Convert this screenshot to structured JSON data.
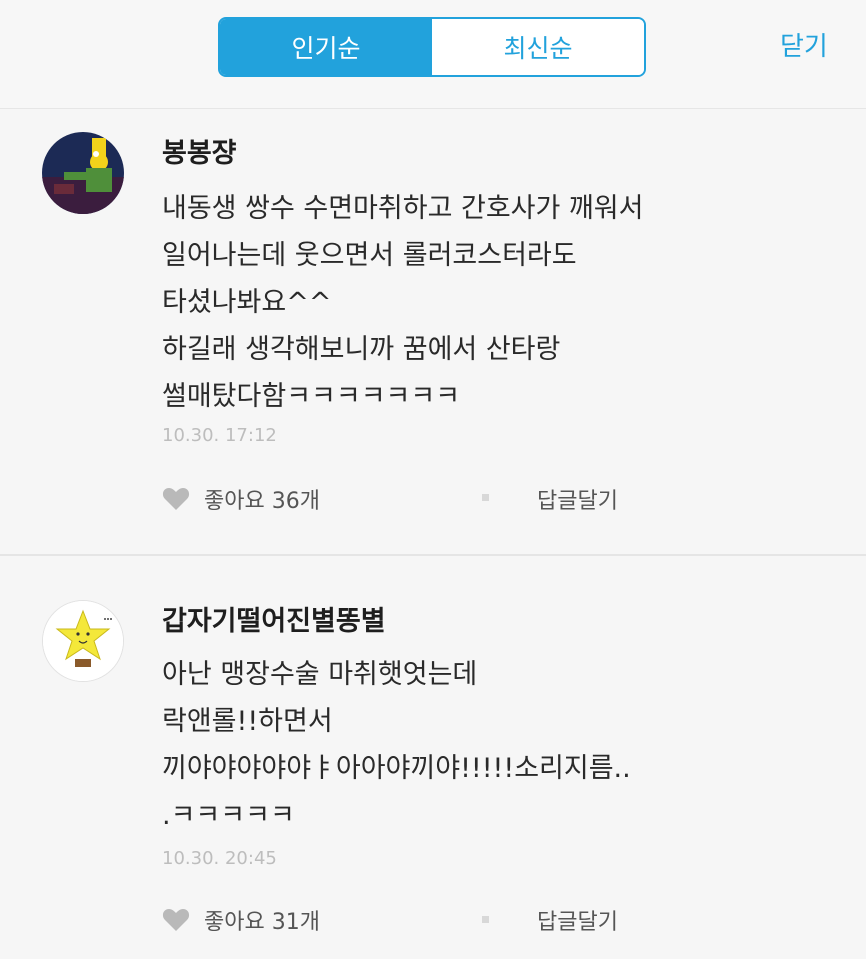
{
  "header": {
    "tabs": [
      {
        "label": "인기순",
        "active": true
      },
      {
        "label": "최신순",
        "active": false
      }
    ],
    "close_label": "닫기"
  },
  "colors": {
    "accent": "#22a2dc",
    "background": "#f6f6f6",
    "timestamp": "#bdbdbd",
    "heart": "#b9b9b9"
  },
  "comments": [
    {
      "author": "봉봉쟝",
      "avatar_icon": "cartoon-character-avatar",
      "lines": [
        "내동생 쌍수 수면마취하고 간호사가 깨워서",
        "일어나는데 웃으면서 롤러코스터라도",
        "타셨나봐요^^",
        "하길래 생각해보니까 꿈에서 산타랑",
        "썰매탔다함ㅋㅋㅋㅋㅋㅋㅋ"
      ],
      "time": "10.30. 17:12",
      "like_label": "좋아요 36개",
      "reply_label": "답글달기"
    },
    {
      "author": "갑자기떨어진별똥별",
      "avatar_icon": "yellow-star-avatar",
      "lines": [
        "아난 맹장수술 마취햇엇는데",
        "락앤롤!!하면서",
        "끼야야야야야ㅑ아아야끼야!!!!!소리지름..",
        ".ㅋㅋㅋㅋㅋ"
      ],
      "time": "10.30. 20:45",
      "like_label": "좋아요 31개",
      "reply_label": "답글달기"
    }
  ]
}
